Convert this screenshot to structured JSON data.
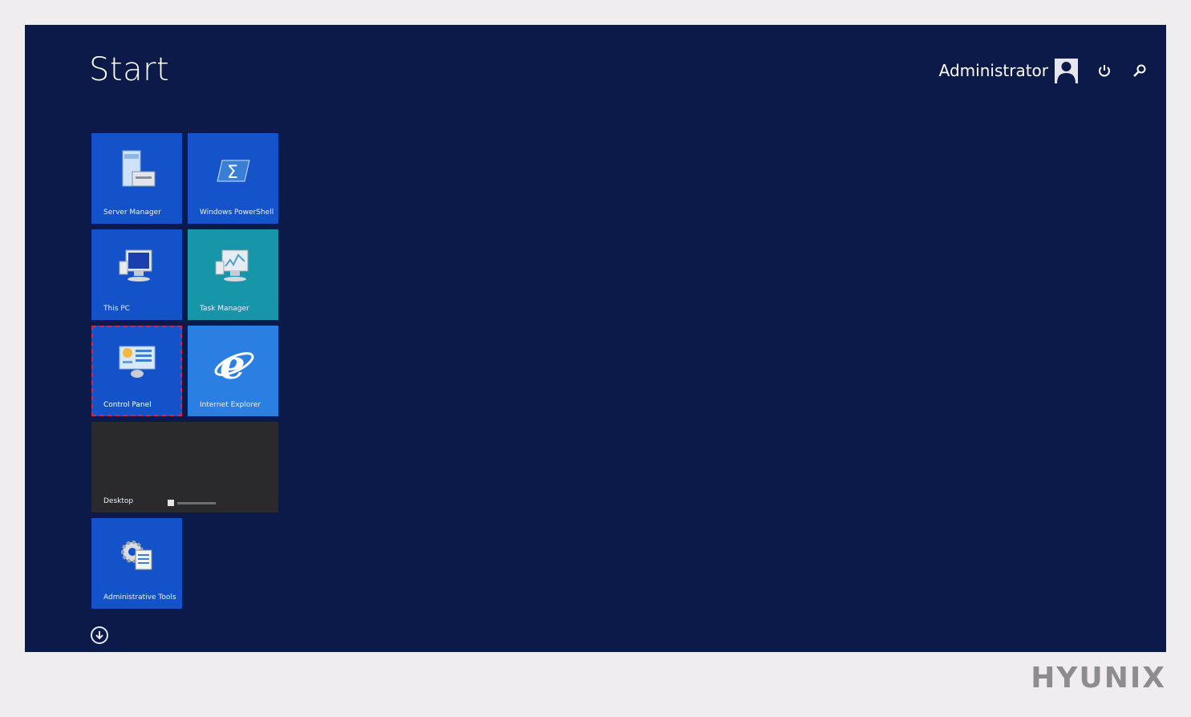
{
  "start": {
    "title": "Start"
  },
  "header": {
    "user_name": "Administrator"
  },
  "tiles": [
    {
      "label": "Server Manager",
      "color": "#1352c8"
    },
    {
      "label": "Windows PowerShell",
      "color": "#1453c9"
    },
    {
      "label": "This PC",
      "color": "#1352c8"
    },
    {
      "label": "Task Manager",
      "color": "#1696a8"
    },
    {
      "label": "Control Panel",
      "color": "#1352c8"
    },
    {
      "label": "Internet Explorer",
      "color": "#2b7fe3"
    },
    {
      "label": "Desktop",
      "color": "#2a2a2c"
    },
    {
      "label": "Administrative Tools",
      "color": "#1352c8"
    }
  ],
  "brand": {
    "name": "HYUNIX"
  },
  "colors": {
    "screen_bg": "#0b1a48",
    "page_bg": "#efedef",
    "selection": "#d8263a"
  }
}
